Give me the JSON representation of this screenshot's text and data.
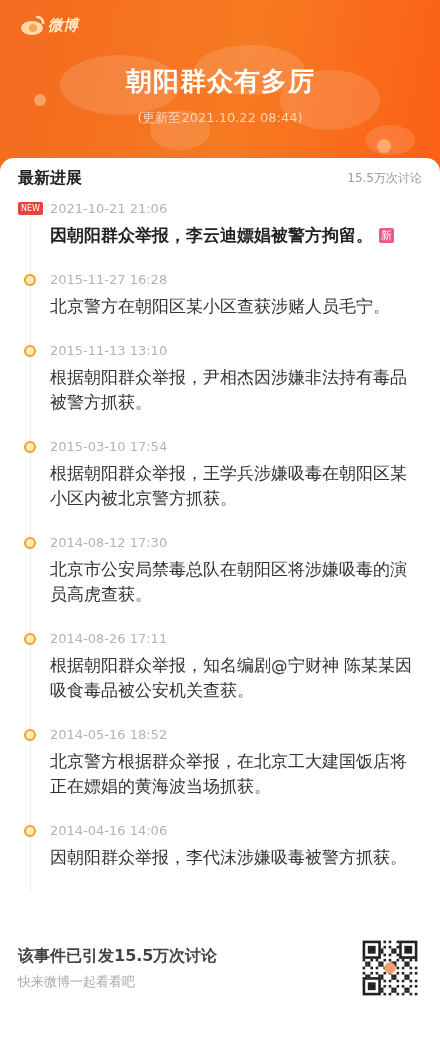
{
  "header": {
    "logo_text": "微博",
    "title": "朝阳群众有多厉",
    "updated": "(更新至2021.10.22 08:44)"
  },
  "card": {
    "heading": "最新进展",
    "discussion_count": "15.5万次讨论",
    "items": [
      {
        "kind": "new",
        "badge": "NEW",
        "date": "2021-10-21 21:06",
        "text": "因朝阳群众举报，李云迪嫖娼被警方拘留。",
        "tag": "新"
      },
      {
        "kind": "normal",
        "date": "2015-11-27 16:28",
        "text": "北京警方在朝阳区某小区查获涉赌人员毛宁。"
      },
      {
        "kind": "normal",
        "date": "2015-11-13 13:10",
        "text": "根据朝阳群众举报，尹相杰因涉嫌非法持有毒品被警方抓获。"
      },
      {
        "kind": "normal",
        "date": "2015-03-10 17:54",
        "text": "根据朝阳群众举报，王学兵涉嫌吸毒在朝阳区某小区内被北京警方抓获。"
      },
      {
        "kind": "normal",
        "date": "2014-08-12 17:30",
        "text": "北京市公安局禁毒总队在朝阳区将涉嫌吸毒的演员高虎查获。"
      },
      {
        "kind": "normal",
        "date": "2014-08-26 17:11",
        "text": "根据朝阳群众举报，知名编剧@宁财神 陈某某因吸食毒品被公安机关查获。"
      },
      {
        "kind": "normal",
        "date": "2014-05-16 18:52",
        "text": "北京警方根据群众举报，在北京工大建国饭店将正在嫖娼的黄海波当场抓获。"
      },
      {
        "kind": "normal",
        "date": "2014-04-16 14:06",
        "text": "因朝阳群众举报，李代沫涉嫌吸毒被警方抓获。"
      }
    ]
  },
  "footer": {
    "title": "该事件已引发15.5万次讨论",
    "subtitle": "快来微博一起看看吧"
  }
}
